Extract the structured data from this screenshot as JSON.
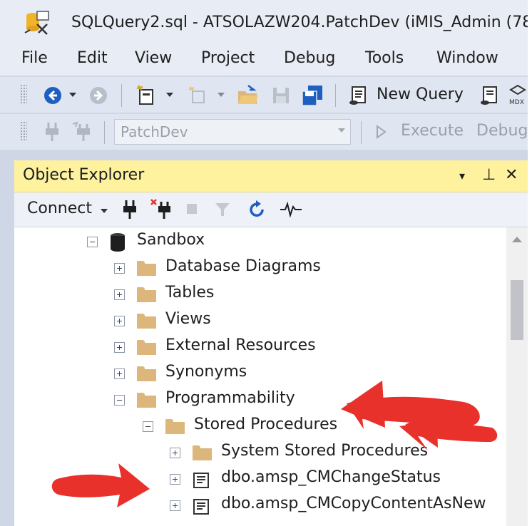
{
  "window": {
    "title": "SQLQuery2.sql - ATSOLAZW204.PatchDev (iMIS_Admin (78)"
  },
  "menu": [
    "File",
    "Edit",
    "View",
    "Project",
    "Debug",
    "Tools",
    "Window"
  ],
  "toolbar": {
    "new_query_label": "New Query",
    "database_selector": "PatchDev",
    "execute_label": "Execute",
    "debug_label": "Debug",
    "icons": [
      "back-icon",
      "forward-icon",
      "new-project-icon",
      "add-item-icon",
      "open-file-icon",
      "save-icon",
      "save-all-icon",
      "new-query-icon",
      "mdx-query-icon",
      "connect-icon",
      "disconnect-icon",
      "execute-icon"
    ]
  },
  "object_explorer": {
    "title": "Object Explorer",
    "header_controls": [
      "▾",
      "⊥",
      "✕"
    ],
    "connect_label": "Connect",
    "tree": {
      "root": "Sandbox",
      "children": [
        "Database Diagrams",
        "Tables",
        "Views",
        "External Resources",
        "Synonyms",
        "Programmability"
      ],
      "programmability_child": "Stored Procedures",
      "stored_procedures": [
        "System Stored Procedures",
        "dbo.amsp_CMChangeStatus",
        "dbo.amsp_CMCopyContentAsNew"
      ]
    }
  },
  "colors": {
    "chrome": "#cfd6e5",
    "panel_header": "#fef29f",
    "folder": "#dcb67a",
    "annotation_arrow": "#e8312a"
  }
}
